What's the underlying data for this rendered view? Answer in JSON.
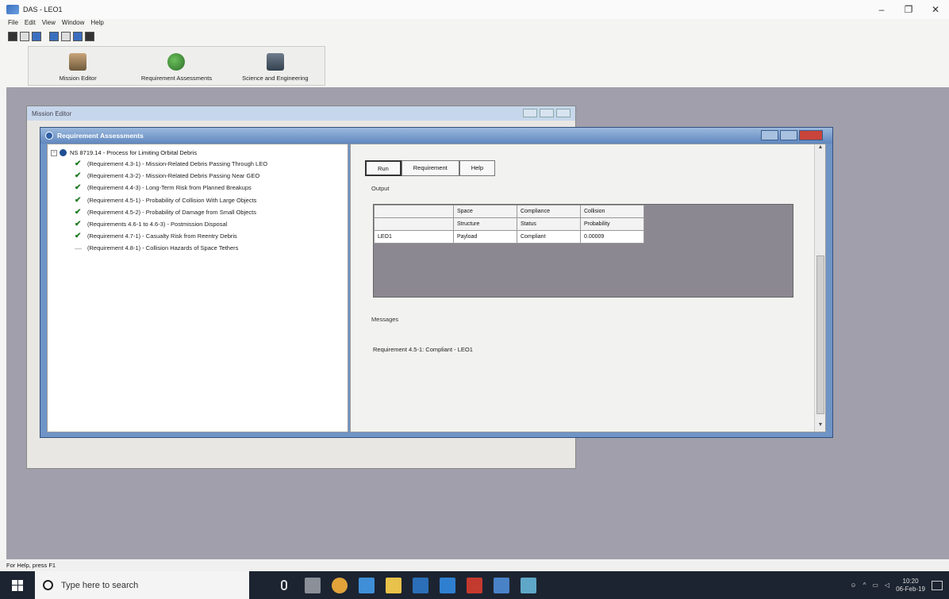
{
  "app": {
    "title": "DAS - LEO1",
    "window_controls": [
      "–",
      "❐",
      "✕"
    ]
  },
  "menu": [
    "File",
    "Edit",
    "View",
    "Window",
    "Help"
  ],
  "modules": [
    {
      "label": "Mission Editor",
      "icon": "mission-editor-icon"
    },
    {
      "label": "Requirement Assessments",
      "icon": "requirement-assessments-icon"
    },
    {
      "label": "Science and Engineering",
      "icon": "science-engineering-icon"
    }
  ],
  "background_window": {
    "title": "Mission Editor"
  },
  "ra_window": {
    "title": "Requirement Assessments",
    "tree": {
      "root": "NS 8719.14 - Process for Limiting Orbital Debris",
      "items": [
        {
          "label": "(Requirement 4.3-1) - Mission-Related Debris Passing Through LEO",
          "status": "check"
        },
        {
          "label": "(Requirement 4.3-2) - Mission-Related Debris Passing Near GEO",
          "status": "check"
        },
        {
          "label": "(Requirement 4.4-3) - Long-Term Risk from Planned Breakups",
          "status": "check"
        },
        {
          "label": "(Requirement 4.5-1) - Probability of Collision With Large Objects",
          "status": "check"
        },
        {
          "label": "(Requirement 4.5-2) - Probability of Damage from Small Objects",
          "status": "check"
        },
        {
          "label": "(Requirements 4.6-1 to 4.6-3) - Postmission Disposal",
          "status": "check"
        },
        {
          "label": "(Requirement 4.7-1) - Casualty Risk from Reentry Debris",
          "status": "check"
        },
        {
          "label": "(Requirement 4.8-1) - Collision Hazards of Space Tethers",
          "status": "none"
        }
      ]
    },
    "buttons": {
      "run": "Run",
      "requirement": "Requirement",
      "help": "Help"
    },
    "output_label": "Output",
    "output_table": {
      "header1": [
        "",
        "Space",
        "Compliance",
        "Collision"
      ],
      "header2": [
        "",
        "Structure",
        "Status",
        "Probability"
      ],
      "rows": [
        [
          "LEO1",
          "Payload",
          "Compliant",
          "0.00009"
        ]
      ]
    },
    "messages_label": "Messages",
    "messages": [
      "Requirement 4.5-1: Compliant - LEO1"
    ]
  },
  "status_bar": "For Help, press F1",
  "taskbar": {
    "search_placeholder": "Type here to search",
    "clock_time": "10:20",
    "clock_date": "06-Feb-19"
  }
}
